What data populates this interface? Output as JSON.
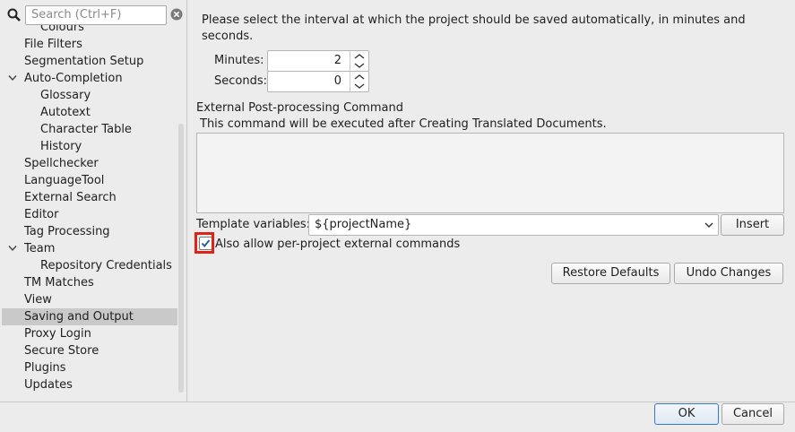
{
  "search": {
    "placeholder": "Search (Ctrl+F)"
  },
  "tree": {
    "items": [
      {
        "label": "Colours",
        "level": 2
      },
      {
        "label": "File Filters",
        "level": 1
      },
      {
        "label": "Segmentation Setup",
        "level": 1
      },
      {
        "label": "Auto-Completion",
        "level": 1,
        "expanded": true
      },
      {
        "label": "Glossary",
        "level": 2
      },
      {
        "label": "Autotext",
        "level": 2
      },
      {
        "label": "Character Table",
        "level": 2
      },
      {
        "label": "History",
        "level": 2
      },
      {
        "label": "Spellchecker",
        "level": 1
      },
      {
        "label": "LanguageTool",
        "level": 1
      },
      {
        "label": "External Search",
        "level": 1
      },
      {
        "label": "Editor",
        "level": 1
      },
      {
        "label": "Tag Processing",
        "level": 1
      },
      {
        "label": "Team",
        "level": 1,
        "expanded": true
      },
      {
        "label": "Repository Credentials",
        "level": 2
      },
      {
        "label": "TM Matches",
        "level": 1
      },
      {
        "label": "View",
        "level": 1
      },
      {
        "label": "Saving and Output",
        "level": 1,
        "selected": true
      },
      {
        "label": "Proxy Login",
        "level": 1
      },
      {
        "label": "Secure Store",
        "level": 1
      },
      {
        "label": "Plugins",
        "level": 1
      },
      {
        "label": "Updates",
        "level": 1
      }
    ]
  },
  "panel": {
    "intro_line1": "Please select the interval at which the project should be saved automatically, in minutes and",
    "intro_line2": "seconds.",
    "minutes_label": "Minutes:",
    "minutes_value": "2",
    "seconds_label": "Seconds:",
    "seconds_value": "0",
    "ext_title": "External Post-processing Command",
    "ext_desc": "This command will be executed after Creating Translated Documents.",
    "command_value": "",
    "template_label": "Template variables:",
    "template_value": "${projectName}",
    "insert_button": "Insert",
    "allow_label": "Also allow per-project external commands",
    "allow_checked": true,
    "restore_button": "Restore Defaults",
    "undo_button": "Undo Changes"
  },
  "footer": {
    "ok_button": "OK",
    "cancel_button": "Cancel"
  }
}
